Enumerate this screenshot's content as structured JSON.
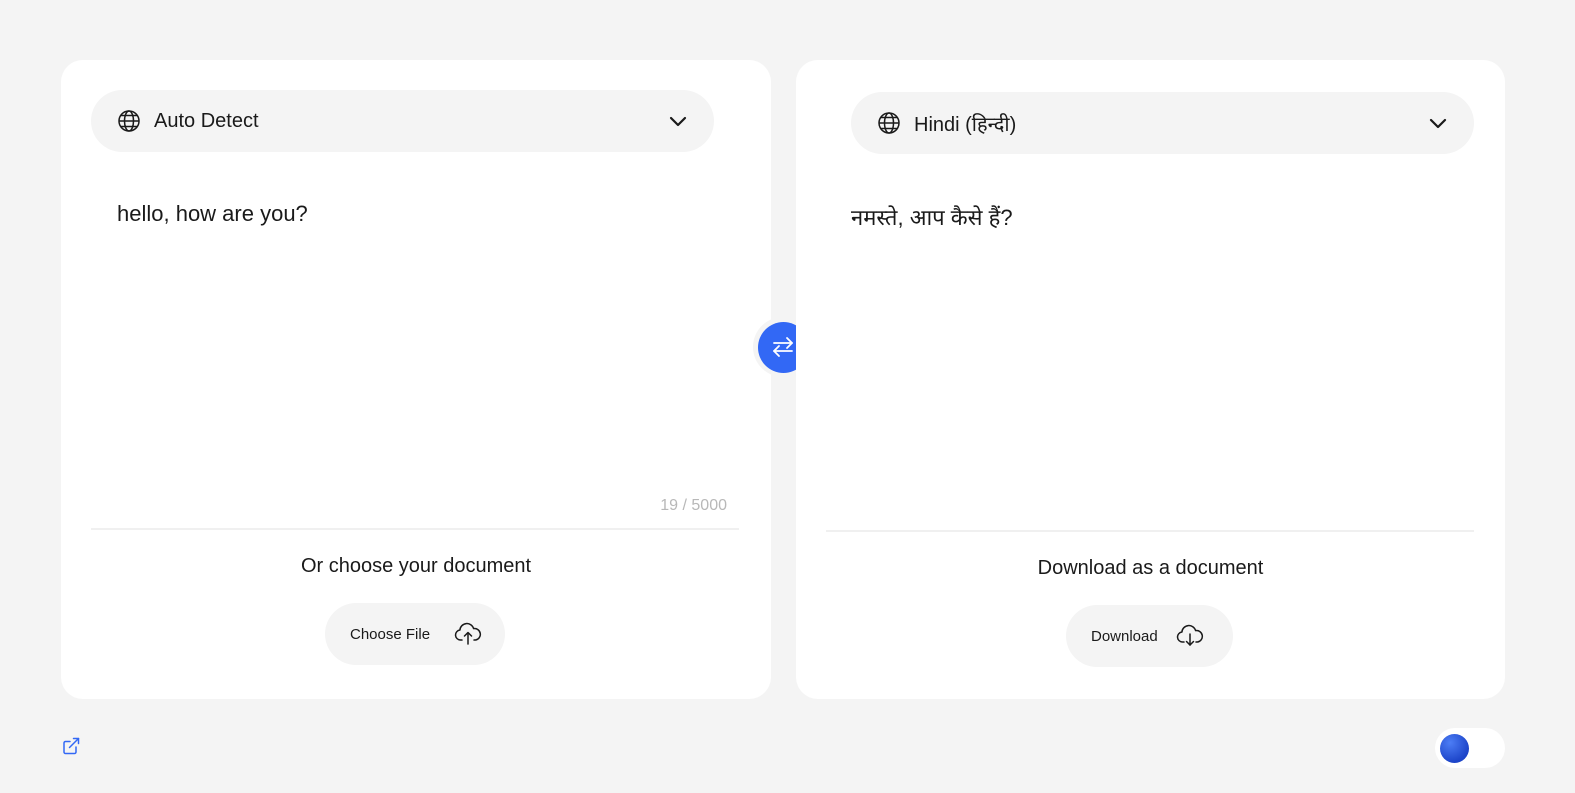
{
  "source": {
    "language_label": "Auto Detect",
    "text": "hello, how are you?",
    "char_count": "19 / 5000",
    "doc_caption": "Or choose your document",
    "button_label": "Choose File"
  },
  "target": {
    "language_label": "Hindi (हिन्दी)",
    "text": "नमस्ते, आप कैसे हैं?",
    "doc_caption": "Download as a document",
    "button_label": "Download"
  },
  "icons": {
    "language": "globe-icon",
    "dropdown": "chevron-down-icon",
    "swap": "swap-arrows-icon",
    "upload": "cloud-upload-icon",
    "download": "cloud-download-icon",
    "external": "external-link-icon"
  },
  "colors": {
    "accent": "#3268f5",
    "background": "#f4f4f4",
    "panel": "#ffffff",
    "muted_text": "#b8b8b8"
  },
  "theme_toggle": {
    "state": "off"
  }
}
